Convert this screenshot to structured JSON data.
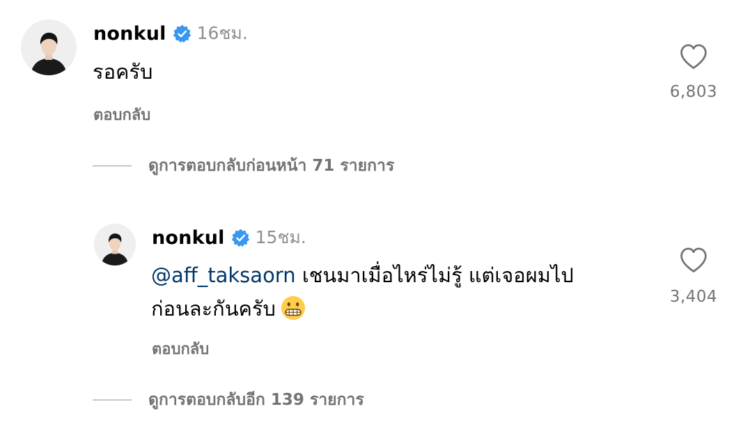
{
  "comments": [
    {
      "username": "nonkul",
      "verified": true,
      "time": "16ชม.",
      "text": "รอครับ",
      "reply_label": "ตอบกลับ",
      "like_count": "6,803",
      "avatar_icon": "user-avatar"
    }
  ],
  "view_previous_replies": "ดูการตอบกลับก่อนหน้า 71 รายการ",
  "replies": [
    {
      "username": "nonkul",
      "verified": true,
      "time": "15ชม.",
      "mention": "@aff_taksaorn",
      "text_line1": " เชนมาเมื่อไหร่ไม่รู้ แต่เจอผมไป",
      "text_line2": "ก่อนละกันครับ",
      "emoji": "grimacing-face",
      "reply_label": "ตอบกลับ",
      "like_count": "3,404",
      "avatar_icon": "user-avatar"
    }
  ],
  "view_more_replies": "ดูการตอบกลับอีก 139 รายการ",
  "colors": {
    "verified_badge": "#3897f0",
    "mention": "#00376b",
    "secondary_text": "#737373",
    "timestamp": "#8e8e8e",
    "divider": "#c7c7c7"
  }
}
